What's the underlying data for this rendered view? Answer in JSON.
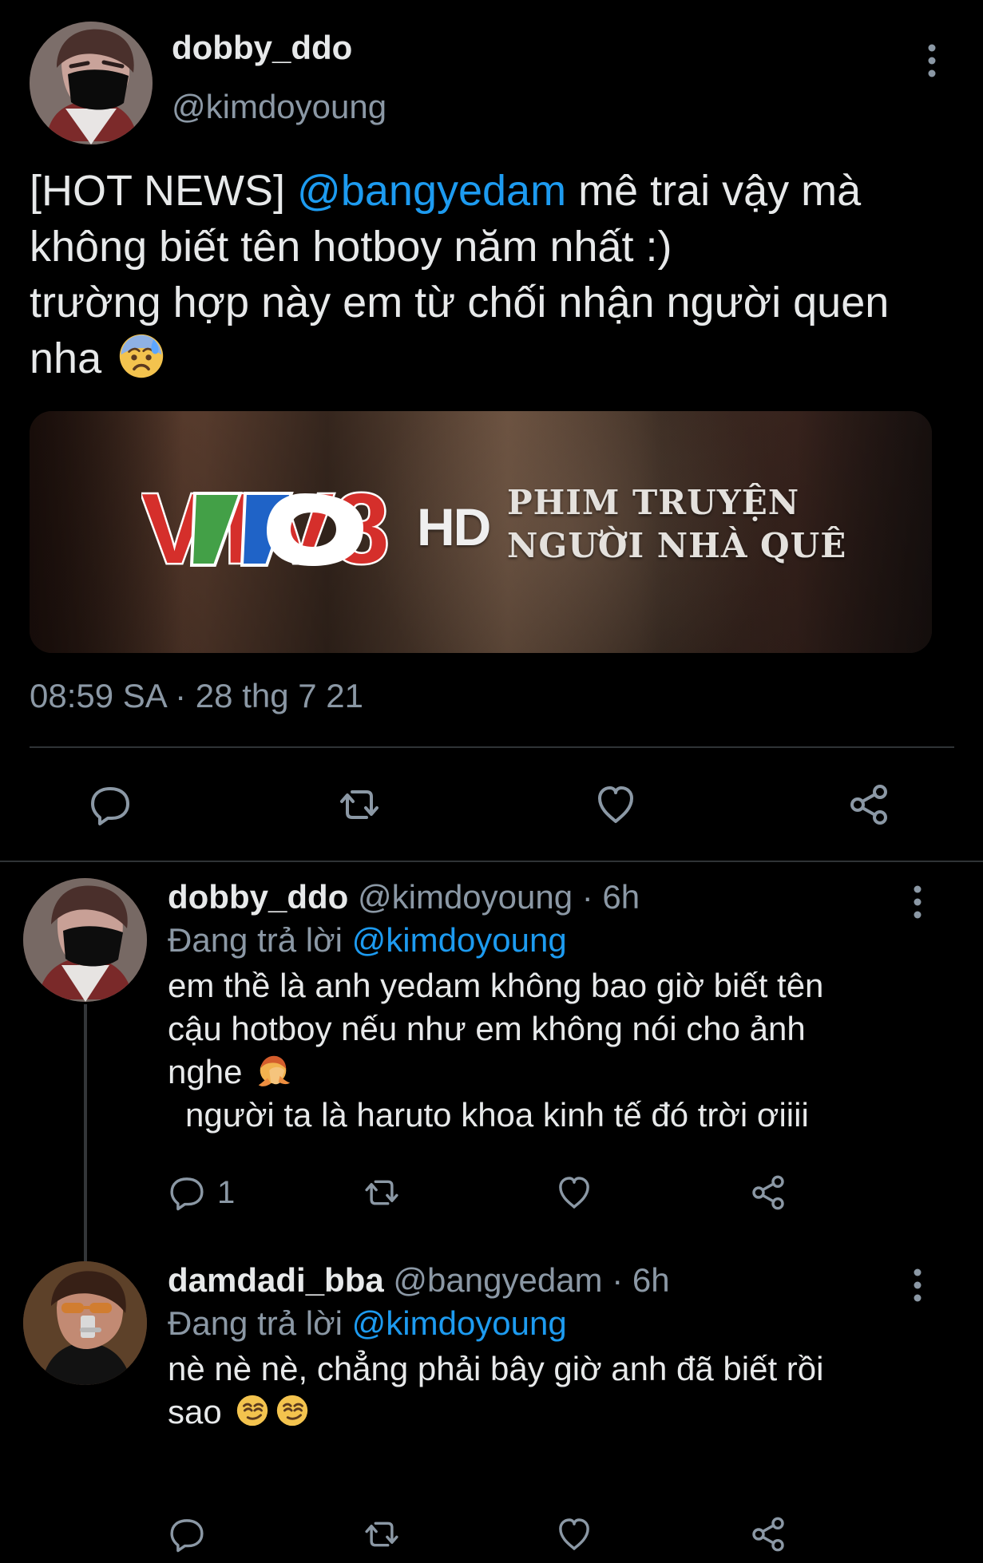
{
  "main_tweet": {
    "display_name": "dobby_ddo",
    "handle": "@kimdoyoung",
    "text_lines": [
      {
        "prefix": "[HOT NEWS] ",
        "mention": "@bangyedam",
        "suffix": " mê trai vậy mà"
      },
      {
        "text": "không biết tên hotboy năm nhất :)"
      },
      {
        "text": "trường hợp này em từ chối nhận người quen"
      },
      {
        "text": "nha "
      }
    ],
    "emoji_name": "anxious-face-with-sweat-icon",
    "image": {
      "logo_text": "VTV8",
      "hd_text": "HD",
      "program_type": "PHIM TRUYỆN",
      "program_title": "NGƯỜI NHÀ QUÊ"
    },
    "timestamp": "08:59 SA · 28 thg 7 21"
  },
  "replies": [
    {
      "display_name": "dobby_ddo",
      "handle": "@kimdoyoung",
      "separator": " · ",
      "time": "6h",
      "replying_label": "Đang trả lời ",
      "replying_to": "@kimdoyoung",
      "text_lines": [
        "em thề là anh yedam không bao giờ biết tên",
        "cậu hotboy nếu như em không nói cho ảnh",
        "nghe ",
        "người ta là haruto khoa kinh tế đó trời ơiiii"
      ],
      "emoji_name": "facepalm-icon",
      "reply_count": "1"
    },
    {
      "display_name": "damdadi_bba",
      "handle": "@bangyedam",
      "separator": " · ",
      "time": "6h",
      "replying_label": "Đang trả lời ",
      "replying_to": "@kimdoyoung",
      "text_lines": [
        "nè nè nè, chẳng phải bây giờ anh đã biết rồi",
        "sao "
      ],
      "emoji_name": "smirking-face-icon"
    }
  ],
  "colors": {
    "background": "#000000",
    "text": "#e7e9ea",
    "muted": "#8b98a5",
    "accent": "#1d9bf0",
    "divider": "#2f3336"
  },
  "icons": {
    "reply": "reply-icon",
    "retweet": "retweet-icon",
    "like": "heart-icon",
    "share": "share-icon",
    "more": "more-options-icon"
  }
}
